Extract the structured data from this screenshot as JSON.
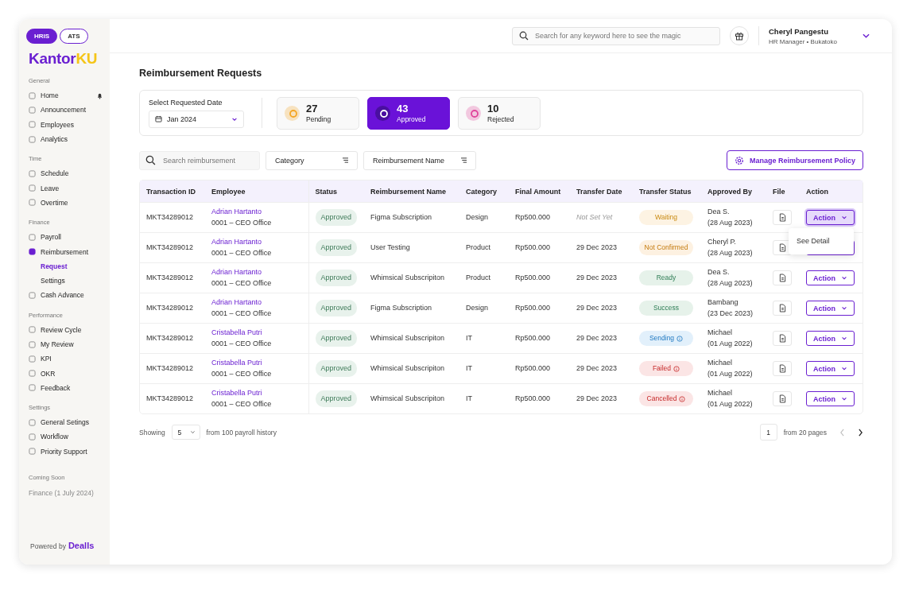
{
  "app_switch": [
    {
      "label": "HRIS",
      "selected": true
    },
    {
      "label": "ATS",
      "selected": false
    }
  ],
  "logo": {
    "main": "Kantor",
    "accent": "KU"
  },
  "sidebar": {
    "sections": [
      {
        "title": "General",
        "items": [
          {
            "label": "Home",
            "selected": false,
            "notification": true
          },
          {
            "label": "Announcement",
            "selected": false,
            "notification": false
          },
          {
            "label": "Employees",
            "selected": false,
            "notification": false
          },
          {
            "label": "Analytics",
            "selected": false,
            "notification": false
          }
        ]
      },
      {
        "title": "Time",
        "items": [
          {
            "label": "Schedule",
            "selected": false,
            "notification": false
          },
          {
            "label": "Leave",
            "selected": false,
            "notification": false
          },
          {
            "label": "Overtime",
            "selected": false,
            "notification": false
          }
        ]
      },
      {
        "title": "Finance",
        "items": [
          {
            "label": "Payroll",
            "selected": false,
            "notification": false
          },
          {
            "label": "Reimbursement",
            "selected": true,
            "notification": false,
            "children": [
              {
                "label": "Request",
                "selected": true
              },
              {
                "label": "Settings",
                "selected": false
              }
            ]
          },
          {
            "label": "Cash Advance",
            "selected": false,
            "notification": false
          }
        ]
      },
      {
        "title": "Performance",
        "items": [
          {
            "label": "Review Cycle",
            "selected": false,
            "notification": false
          },
          {
            "label": "My Review",
            "selected": false,
            "notification": false
          },
          {
            "label": "KPI",
            "selected": false,
            "notification": false
          },
          {
            "label": "OKR",
            "selected": false,
            "notification": false
          },
          {
            "label": "Feedback",
            "selected": false,
            "notification": false
          }
        ]
      },
      {
        "title": "Settings",
        "items": [
          {
            "label": "General Setings",
            "selected": false,
            "notification": false
          },
          {
            "label": "Workflow",
            "selected": false,
            "notification": false
          },
          {
            "label": "Priority Support",
            "selected": false,
            "notification": false
          }
        ]
      }
    ],
    "coming_soon": {
      "title": "Coming Soon",
      "items": [
        "Finance (1 July 2024)"
      ]
    },
    "powered_by": {
      "label": "Powered by",
      "brand": "Dealls"
    }
  },
  "header": {
    "search": {
      "placeholder": "Search for any keyword here to see the magic"
    },
    "user": {
      "name": "Cheryl Pangestu",
      "role": "HR Manager • Bukatoko"
    }
  },
  "page_title": "Reimbursement Requests",
  "date_filter": {
    "label": "Select Requested Date",
    "value": "Jan 2024"
  },
  "stats": [
    {
      "count": "27",
      "label": "Pending",
      "selected": false,
      "color": "#f5a623"
    },
    {
      "count": "43",
      "label": "Approved",
      "selected": true,
      "color": "#ffffff"
    },
    {
      "count": "10",
      "label": "Rejected",
      "selected": false,
      "color": "#e0459b"
    }
  ],
  "filters": {
    "search": {
      "placeholder": "Search reimbursement"
    },
    "dropdowns": [
      "Category",
      "Reimbursement Name"
    ],
    "policy_button": "Manage Reimbursement Policy"
  },
  "table": {
    "columns": [
      "Transaction ID",
      "Employee",
      "Status",
      "Reimbursement Name",
      "Category",
      "Final Amount",
      "Transfer Date",
      "Transfer Status",
      "Approved By",
      "File",
      "Action"
    ],
    "rows": [
      {
        "id": "MKT34289012",
        "employee": "Adrian Hartanto",
        "department": "0001 – CEO Office",
        "status": "Approved",
        "name": "Figma Subscription",
        "category": "Design",
        "amount": "Rp500.000",
        "transfer_date": "Not Set Yet",
        "date_set": false,
        "transfer_status": {
          "label": "Waiting",
          "kind": "pending",
          "info": false
        },
        "approver": "Dea S.",
        "approved_on": "(28 Aug 2023)",
        "action": "Action",
        "menu_open": true
      },
      {
        "id": "MKT34289012",
        "employee": "Adrian Hartanto",
        "department": "0001 – CEO Office",
        "status": "Approved",
        "name": "User Testing",
        "category": "Product",
        "amount": "Rp500.000",
        "transfer_date": "29 Dec 2023",
        "date_set": true,
        "transfer_status": {
          "label": "Not Confirmed",
          "kind": "warning",
          "info": false
        },
        "approver": "Cheryl P.",
        "approved_on": "(28 Aug 2023)",
        "menu_open": false
      },
      {
        "id": "MKT34289012",
        "employee": "Adrian Hartanto",
        "department": "0001 – CEO Office",
        "status": "Approved",
        "name": "Whimsical Subscripiton",
        "category": "Product",
        "amount": "Rp500.000",
        "transfer_date": "29 Dec 2023",
        "date_set": true,
        "transfer_status": {
          "label": "Ready",
          "kind": "success",
          "info": false
        },
        "approver": "Dea S.",
        "approved_on": "(28 Aug 2023)",
        "action": "Action",
        "menu_open": false
      },
      {
        "id": "MKT34289012",
        "employee": "Adrian Hartanto",
        "department": "0001 – CEO Office",
        "status": "Approved",
        "name": "Figma Subscription",
        "category": "Design",
        "amount": "Rp500.000",
        "transfer_date": "29 Dec 2023",
        "date_set": true,
        "transfer_status": {
          "label": "Success",
          "kind": "success",
          "info": false
        },
        "approver": "Bambang",
        "approved_on": "(23 Dec 2023)",
        "action": "Action",
        "menu_open": false
      },
      {
        "id": "MKT34289012",
        "employee": "Cristabella Putri",
        "department": "0001 – CEO Office",
        "status": "Approved",
        "name": "Whimsical Subscripiton",
        "category": "IT",
        "amount": "Rp500.000",
        "transfer_date": "29 Dec 2023",
        "date_set": true,
        "transfer_status": {
          "label": "Sending",
          "kind": "info",
          "info": true
        },
        "approver": "Michael",
        "approved_on": "(01 Aug 2022)",
        "action": "Action",
        "menu_open": false
      },
      {
        "id": "MKT34289012",
        "employee": "Cristabella Putri",
        "department": "0001 – CEO Office",
        "status": "Approved",
        "name": "Whimsical Subscripiton",
        "category": "IT",
        "amount": "Rp500.000",
        "transfer_date": "29 Dec 2023",
        "date_set": true,
        "transfer_status": {
          "label": "Failed",
          "kind": "danger",
          "info": true
        },
        "approver": "Michael",
        "approved_on": "(01 Aug 2022)",
        "action": "Action",
        "menu_open": false
      },
      {
        "id": "MKT34289012",
        "employee": "Cristabella Putri",
        "department": "0001 – CEO Office",
        "status": "Approved",
        "name": "Whimsical Subscripiton",
        "category": "IT",
        "amount": "Rp500.000",
        "transfer_date": "29 Dec 2023",
        "date_set": true,
        "transfer_status": {
          "label": "Cancelled",
          "kind": "danger",
          "info": true
        },
        "approver": "Michael",
        "approved_on": "(01 Aug 2022)",
        "action": "Action",
        "menu_open": false
      }
    ]
  },
  "action_menu": {
    "items": [
      "See Detail"
    ]
  },
  "pagination": {
    "showing_label": "Showing",
    "page_size": "5",
    "total_label": "from 100 payroll history",
    "page": "1",
    "pages_label": "from 20 pages"
  }
}
